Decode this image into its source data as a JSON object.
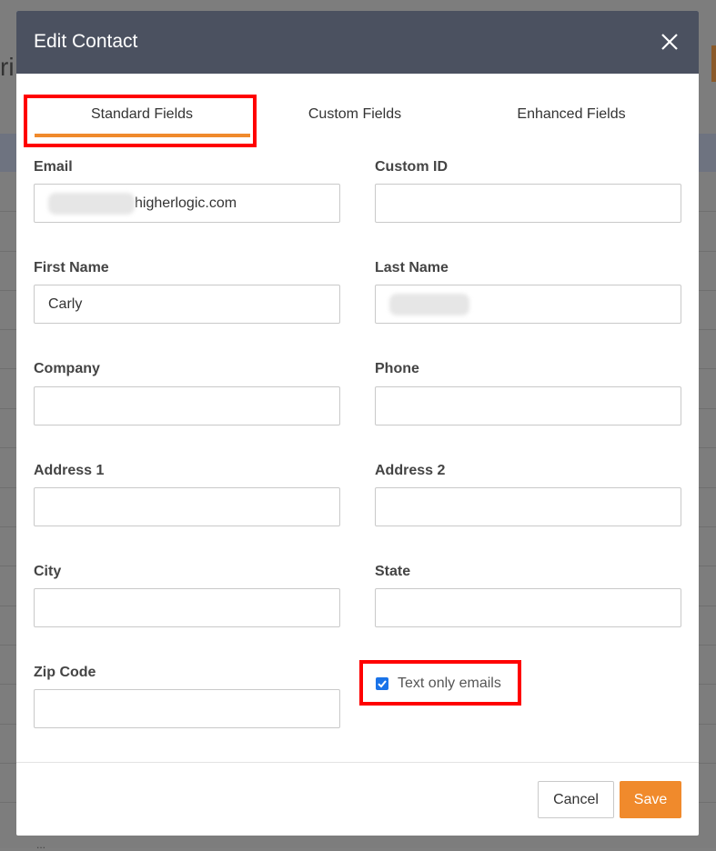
{
  "background": {
    "partial_title": "ri",
    "footer_text": "..."
  },
  "modal": {
    "title": "Edit Contact",
    "close_icon": "close-icon",
    "tabs": [
      {
        "label": "Standard Fields",
        "active": true
      },
      {
        "label": "Custom Fields",
        "active": false
      },
      {
        "label": "Enhanced Fields",
        "active": false
      }
    ],
    "fields": {
      "email": {
        "label": "Email",
        "value": "higherlogic.com"
      },
      "custom_id": {
        "label": "Custom ID",
        "value": ""
      },
      "first_name": {
        "label": "First Name",
        "value": "Carly"
      },
      "last_name": {
        "label": "Last Name",
        "value": ""
      },
      "company": {
        "label": "Company",
        "value": ""
      },
      "phone": {
        "label": "Phone",
        "value": ""
      },
      "address1": {
        "label": "Address 1",
        "value": ""
      },
      "address2": {
        "label": "Address 2",
        "value": ""
      },
      "city": {
        "label": "City",
        "value": ""
      },
      "state": {
        "label": "State",
        "value": ""
      },
      "zip": {
        "label": "Zip Code",
        "value": ""
      }
    },
    "text_only": {
      "label": "Text only emails",
      "checked": true
    },
    "buttons": {
      "cancel": "Cancel",
      "save": "Save"
    }
  },
  "colors": {
    "header_bg": "#4b5160",
    "accent": "#f08a2c",
    "highlight": "#ff0000",
    "checkbox": "#1a73e8"
  }
}
